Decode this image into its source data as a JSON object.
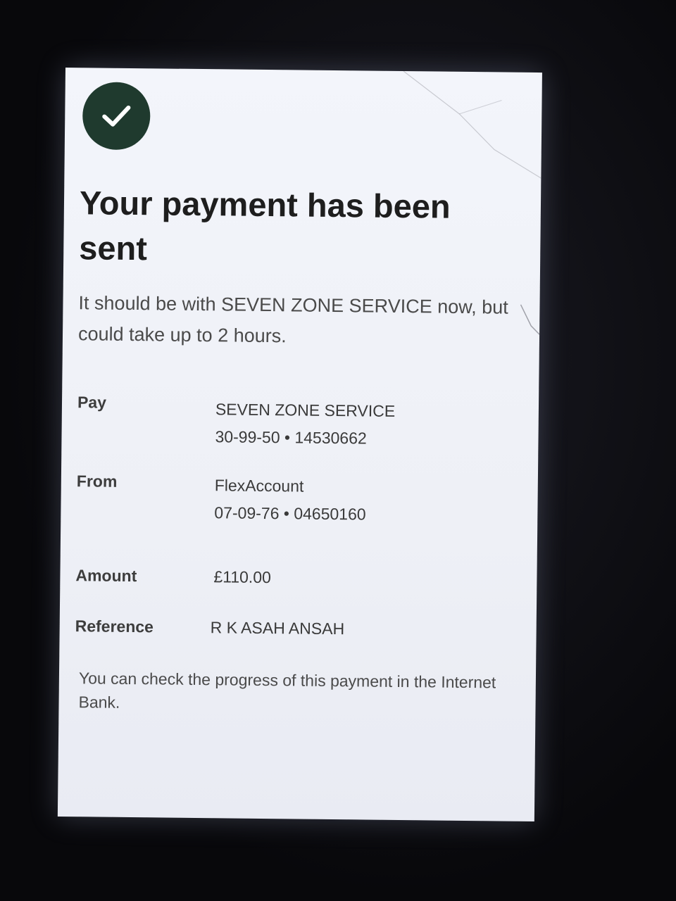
{
  "confirmation": {
    "title": "Your payment has been sent",
    "subtitle": "It should be with SEVEN ZONE SERVICE now, but could take up to 2 hours."
  },
  "details": {
    "pay": {
      "label": "Pay",
      "name": "SEVEN ZONE SERVICE",
      "account": "30-99-50 • 14530662"
    },
    "from": {
      "label": "From",
      "name": "FlexAccount",
      "account": "07-09-76 • 04650160"
    },
    "amount": {
      "label": "Amount",
      "value": "£110.00"
    },
    "reference": {
      "label": "Reference",
      "value": "R K ASAH ANSAH"
    }
  },
  "footer": {
    "note": "You can check the progress of this payment in the Internet Bank."
  },
  "icons": {
    "success": "checkmark-icon"
  },
  "colors": {
    "badge": "#1f3a2e",
    "text": "#1e1e1e"
  }
}
